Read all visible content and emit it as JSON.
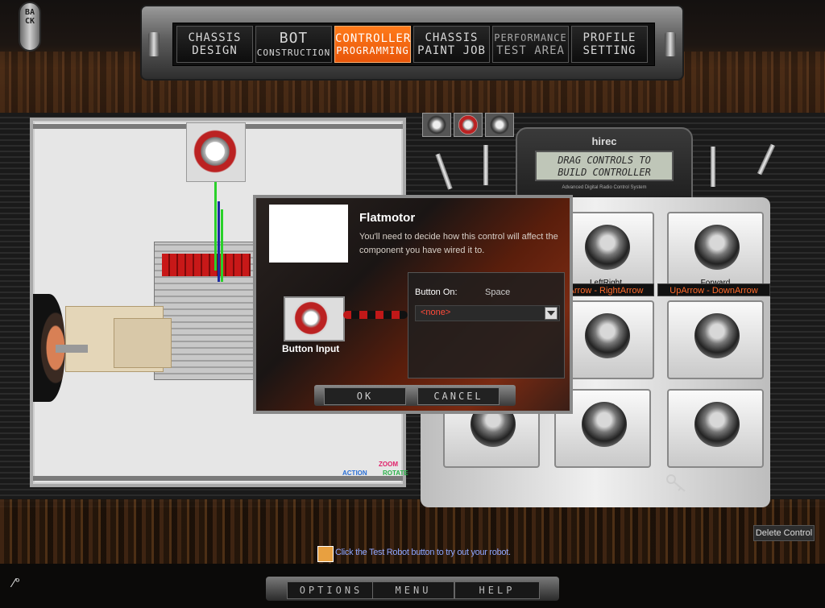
{
  "back_label": "BACK",
  "nav_tabs": [
    {
      "line1": "CHASSIS",
      "line2": "DESIGN"
    },
    {
      "line1": "BOT",
      "line2": "CONSTRUCTION"
    },
    {
      "line1": "CONTROLLER",
      "line2": "PROGRAMMING"
    },
    {
      "line1": "CHASSIS",
      "line2": "PAINT JOB"
    },
    {
      "line1": "PERFORMANCE",
      "line2": "TEST AREA"
    },
    {
      "line1": "PROFILE",
      "line2": "SETTING"
    }
  ],
  "active_tab": "CONTROLLER PROGRAMMING",
  "viewport": {
    "legend_zoom": "ZOOM",
    "legend_action": "ACTION",
    "legend_rotate": "ROTATE"
  },
  "controller": {
    "brand": "hirec",
    "lcd_line1": "DRAG CONTROLS TO",
    "lcd_line2": "BUILD CONTROLLER",
    "lcd_sub": "Advanced Digital Radio Control System",
    "pads": [
      {
        "caption": "LeftRight",
        "mapping": "Arrow - RightArrow"
      },
      {
        "caption": "Forward",
        "mapping": "UpArrow - DownArrow"
      }
    ]
  },
  "dialog": {
    "title": "Flatmotor",
    "description": "You'll need to decide how this control will affect the component you have wired it to.",
    "icon_label": "Button Input",
    "button_on_label": "Button On:",
    "button_on_value": "Space",
    "select_value": "<none>",
    "ok_label": "OK",
    "cancel_label": "CANCEL"
  },
  "hint_text": "Click the Test Robot button to try out your robot.",
  "delete_control_label": "Delete Control",
  "bottom_buttons": {
    "options": "OPTIONS",
    "menu": "MENU",
    "help": "HELP"
  },
  "colors": {
    "accent_orange": "#e8560a",
    "mapping_label": "#ff6a2a",
    "hint_blue": "#8ea6ff",
    "dialog_none_red": "#ff4a3a"
  }
}
